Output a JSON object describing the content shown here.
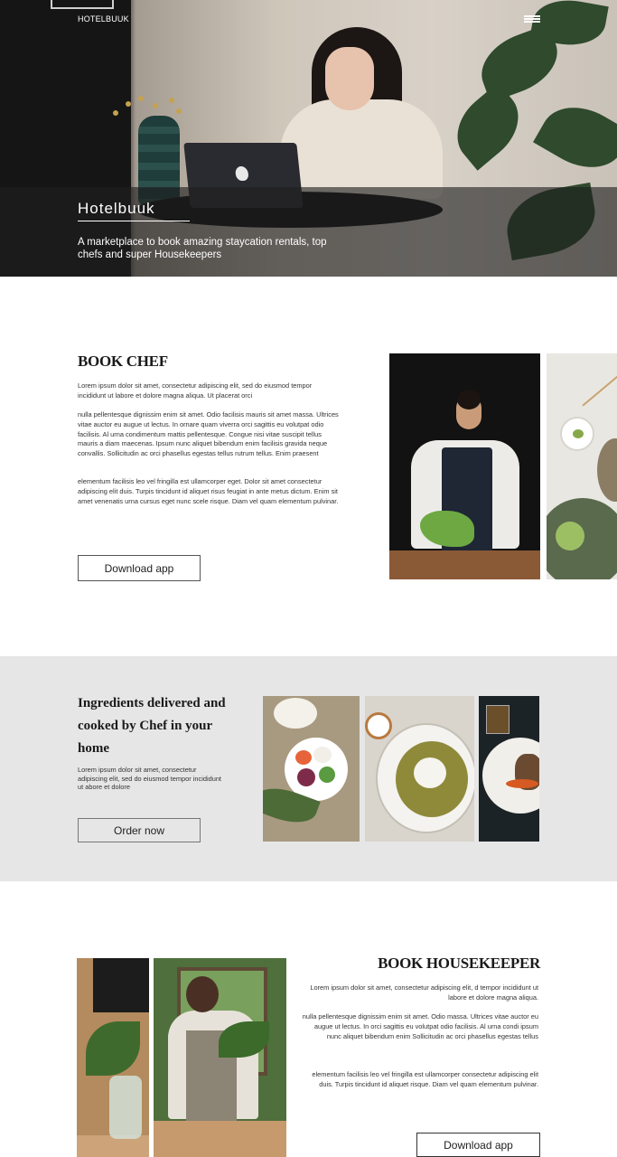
{
  "hero": {
    "brand": "HOTELBUUK",
    "menu_icon": "hamburger-menu-icon",
    "title": "Hotelbuuk",
    "tagline": "A marketplace to book amazing staycation rentals, top chefs and super Housekeepers"
  },
  "book_chef": {
    "heading": "BOOK CHEF",
    "paragraphs": [
      "Lorem ipsum dolor sit amet, consectetur adipiscing elit, sed do eiusmod tempor incididunt ut labore et dolore magna aliqua. Ut placerat orci",
      "nulla pellentesque dignissim enim sit amet. Odio facilisis mauris sit amet massa. Ultrices vitae auctor eu augue ut lectus. In ornare quam viverra orci sagittis eu volutpat odio facilisis. Al urna condimentum mattis pellentesque. Congue nisi vitae suscipit tellus mauris a diam maecenas. Ipsum nunc aliquet bibendum enim facilisis gravida neque convallis. Sollicitudin ac orci phasellus egestas tellus rutrum tellus. Enim praesent",
      "elementum facilisis leo vel fringilla est ullamcorper eget. Dolor sit amet consectetur adipiscing elit duis. Turpis tincidunt id aliquet risus feugiat in ante metus dictum. Enim sit amet venenatis urna cursus eget nunc scele risque. Diam vel quam elementum pulvinar."
    ],
    "button": "Download app"
  },
  "ingredients": {
    "heading": "Ingredients delivered and cooked by Chef in your home",
    "paragraph": "Lorem ipsum dolor sit amet, consectetur adipiscing elit, sed do eiusmod tempor incididunt ut abore et dolore",
    "button": "Order now"
  },
  "book_housekeeper": {
    "heading": "BOOK HOUSEKEEPER",
    "paragraphs": [
      "Lorem ipsum dolor sit amet, consectetur adipiscing elit, d tempor incididunt ut labore et dolore magna aliqua.",
      "nulla pellentesque dignissim enim sit amet. Odio massa. Ultrices vitae auctor eu augue ut lectus. In orci sagittis eu volutpat odio facilisis. Al urna condi ipsum nunc aliquet bibendum enim Sollicitudin ac orci phasellus egestas tellus",
      "elementum facilisis leo vel fringilla est ullamcorper consectetur adipiscing elit duis. Turpis tincidunt id aliquet risque. Diam vel quam elementum pulvinar."
    ],
    "button": "Download app"
  }
}
